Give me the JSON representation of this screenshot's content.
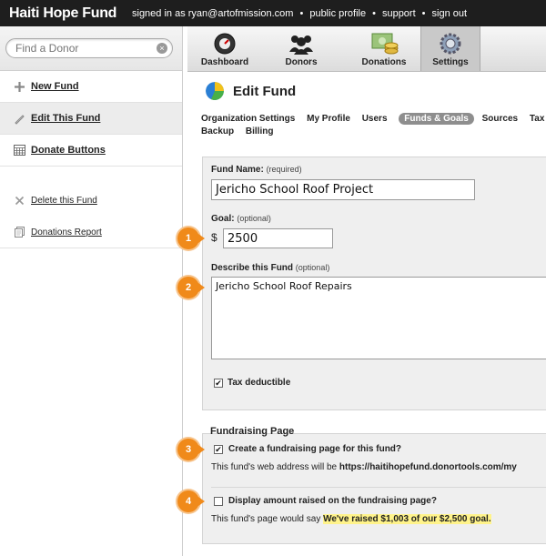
{
  "topbar": {
    "brand": "Haiti Hope Fund",
    "signed_in": "signed in as ryan@artofmission.com",
    "links": [
      "public profile",
      "support",
      "sign out"
    ]
  },
  "sidebar": {
    "search_placeholder": "Find a Donor",
    "items": [
      {
        "label": "New Fund",
        "icon": "plus-icon"
      },
      {
        "label": "Edit This Fund",
        "icon": "pencil-icon"
      },
      {
        "label": "Donate Buttons",
        "icon": "grid-icon"
      }
    ],
    "small_items": [
      {
        "label": "Delete this Fund",
        "icon": "delete-icon"
      },
      {
        "label": "Donations Report",
        "icon": "report-icon"
      }
    ]
  },
  "nav": {
    "tabs": [
      {
        "label": "Dashboard",
        "icon": "dashboard-icon"
      },
      {
        "label": "Donors",
        "icon": "donors-icon"
      },
      {
        "label": "Donations",
        "icon": "donations-icon"
      },
      {
        "label": "Settings",
        "icon": "settings-icon",
        "active": true
      }
    ]
  },
  "page": {
    "title": "Edit Fund",
    "subnav": [
      "Organization Settings",
      "My Profile",
      "Users",
      "Funds & Goals",
      "Sources",
      "Tax &",
      "Backup",
      "Billing"
    ],
    "subnav_active": "Funds & Goals"
  },
  "form": {
    "fund_name_label": "Fund Name:",
    "fund_name_hint": "(required)",
    "fund_name_value": "Jericho School Roof Project",
    "goal_label": "Goal:",
    "goal_hint": "(optional)",
    "currency": "$",
    "goal_value": "2500",
    "describe_label": "Describe this Fund",
    "describe_hint": "(optional)",
    "describe_value": "Jericho School Roof Repairs",
    "tax_label": "Tax deductible",
    "tax_checked": true
  },
  "fundraising": {
    "title": "Fundraising Page",
    "create_label": "Create a fundraising page for this fund?",
    "create_checked": true,
    "address_note": "This fund's web address will be",
    "address_url": "https://haitihopefund.donortools.com/my",
    "display_label": "Display amount raised on the fundraising page?",
    "display_checked": false,
    "would_say_note": "This fund's page would say",
    "would_say_value": "We've raised $1,003 of our $2,500 goal."
  },
  "callouts": [
    "1",
    "2",
    "3",
    "4"
  ],
  "colors": {
    "topbar": "#1e1e1e",
    "callout": "#f08a1a",
    "highlight": "#fff38a",
    "active_tab": "#8e8e8e"
  }
}
